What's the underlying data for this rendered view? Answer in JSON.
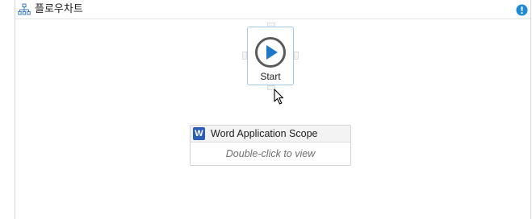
{
  "panel": {
    "title": "플로우차트"
  },
  "start_node": {
    "label": "Start"
  },
  "activity": {
    "icon_letter": "W",
    "title": "Word Application Scope",
    "body_hint": "Double-click to view"
  },
  "colors": {
    "accent_blue": "#1f77c7",
    "node_border": "#9fc8e8",
    "word_blue": "#2b5fb4",
    "warning_blue": "#1f8ad6"
  },
  "icons": {
    "header": "flowchart-icon",
    "warning": "warning-icon",
    "start": "play-icon",
    "activity": "word-icon"
  }
}
